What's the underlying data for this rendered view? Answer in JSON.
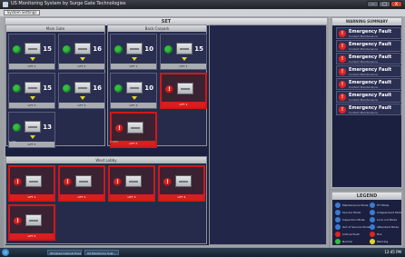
{
  "window": {
    "title": "US Monitoring System by Surge Gate Technologies",
    "min": "–",
    "max": "□",
    "close": "X"
  },
  "menu": {
    "button_label": "System Settings"
  },
  "main_panel": {
    "title": "SET"
  },
  "groups": [
    {
      "name": "Main Gate",
      "tiles": [
        {
          "state": "ok",
          "count": "15",
          "label": "LIFT 1"
        },
        {
          "state": "ok",
          "count": "16",
          "label": "LIFT 2"
        },
        {
          "state": "ok",
          "count": "15",
          "label": "LIFT 3"
        },
        {
          "state": "ok",
          "count": "16",
          "label": "LIFT 4"
        },
        {
          "state": "ok",
          "count": "13",
          "label": "LIFT 5"
        }
      ],
      "footer": "5 Lifts"
    },
    {
      "name": "Back Carpark",
      "tiles": [
        {
          "state": "ok",
          "count": "10",
          "label": "LIFT 1"
        },
        {
          "state": "ok",
          "count": "15",
          "label": "LIFT 2"
        },
        {
          "state": "ok",
          "count": "10",
          "label": "LIFT 3"
        },
        {
          "state": "alarm",
          "count": "",
          "label": "LIFT 4"
        },
        {
          "state": "alarm",
          "count": "",
          "label": "LIFT 5"
        }
      ],
      "footer": "5 Lifts"
    },
    {
      "name": "West Lobby",
      "tiles": [
        {
          "state": "alarm",
          "count": "",
          "label": "LIFT 1"
        },
        {
          "state": "alarm",
          "count": "",
          "label": "LIFT 2"
        },
        {
          "state": "alarm",
          "count": "",
          "label": "LIFT 3"
        },
        {
          "state": "alarm",
          "count": "",
          "label": "LIFT 4"
        },
        {
          "state": "alarm",
          "count": "",
          "label": "LIFT 5"
        }
      ]
    }
  ],
  "warning_panel": {
    "title": "WARNING SUMMARY",
    "items": [
      {
        "title": "Emergency Fault",
        "sub": "Contact Maintenance"
      },
      {
        "title": "Emergency Fault",
        "sub": "Contact Maintenance"
      },
      {
        "title": "Emergency Fault",
        "sub": "Contact Maintenance"
      },
      {
        "title": "Emergency Fault",
        "sub": "Contact Maintenance"
      },
      {
        "title": "Emergency Fault",
        "sub": "Contact Maintenance"
      },
      {
        "title": "Emergency Fault",
        "sub": "Contact Maintenance"
      },
      {
        "title": "Emergency Fault",
        "sub": "Contact Maintenance"
      }
    ]
  },
  "legend": {
    "title": "LEGEND",
    "items": [
      {
        "label": "Maintenance Mode",
        "color": "#3a7bd5"
      },
      {
        "label": "HT Mode",
        "color": "#3a7bd5"
      },
      {
        "label": "Service Mode",
        "color": "#3a7bd5"
      },
      {
        "label": "Independent Mode",
        "color": "#3a7bd5"
      },
      {
        "label": "Inspection Mode",
        "color": "#3a7bd5"
      },
      {
        "label": "Lock-out Mode",
        "color": "#3a7bd5"
      },
      {
        "label": "Out of Service Mode",
        "color": "#3a7bd5"
      },
      {
        "label": "Attendant Mode",
        "color": "#3a7bd5"
      },
      {
        "label": "Critical Fault",
        "color": "#e12323"
      },
      {
        "label": "Fire",
        "color": "#e12323"
      },
      {
        "label": "Normal",
        "color": "#2fc23c"
      },
      {
        "label": "Warning",
        "color": "#e2d62a"
      }
    ]
  },
  "taskbar": {
    "tasks": [
      "Windows Internet Explorer",
      "US Monitoring Syst..."
    ],
    "clock": "12:45 PM"
  }
}
